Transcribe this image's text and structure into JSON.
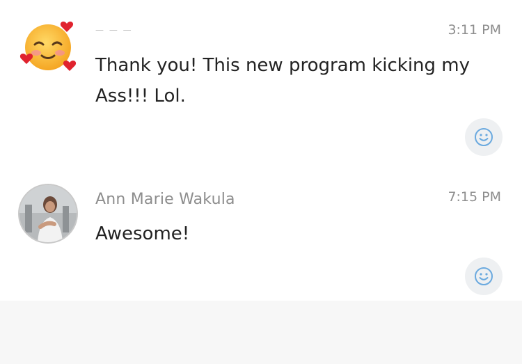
{
  "messages": [
    {
      "sender": "— — —",
      "time": "3:11 PM",
      "text": "Thank you!  This new program kicking my Ass!!!  Lol.",
      "avatar_icon": "smiling-face-with-hearts-icon"
    },
    {
      "sender": "Ann Marie Wakula",
      "time": "7:15 PM",
      "text": "Awesome!",
      "avatar_icon": "profile-photo"
    }
  ],
  "reaction_icon": "smiley-reaction-icon",
  "colors": {
    "reaction_icon": "#6aa9df",
    "text": "#222222",
    "meta": "#8d8d8d"
  }
}
